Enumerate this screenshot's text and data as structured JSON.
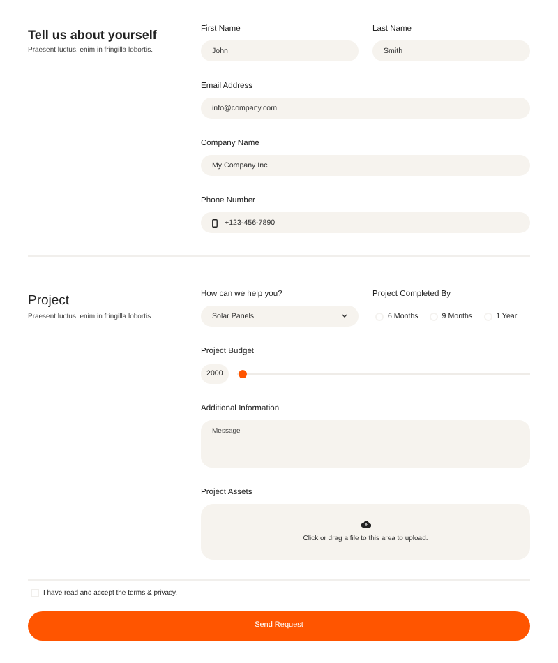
{
  "about": {
    "title": "Tell us about yourself",
    "subtitle": "Praesent luctus, enim in fringilla lobortis.",
    "fields": [
      {
        "label": "First Name",
        "value": "John",
        "kind": "half"
      },
      {
        "label": "Last Name",
        "value": "Smith",
        "kind": "half"
      },
      {
        "label": "Email Address",
        "value": "info@company.com",
        "kind": "full"
      },
      {
        "label": "Company Name",
        "value": "My Company Inc",
        "kind": "full"
      },
      {
        "label": "Phone Number",
        "value": "+123-456-7890",
        "kind": "phone"
      }
    ]
  },
  "project": {
    "title": "Project",
    "subtitle": "Praesent luctus, enim in fringilla lobortis.",
    "help": {
      "label": "How can we help you?",
      "value": "Solar Panels"
    },
    "completed": {
      "label": "Project Completed By",
      "options": [
        {
          "label": "6 Months",
          "selected": false
        },
        {
          "label": "9 Months",
          "selected": false
        },
        {
          "label": "1 Year",
          "selected": false
        }
      ]
    },
    "budget": {
      "label": "Project Budget",
      "reading": "2000",
      "level": 0.02
    },
    "info": {
      "label": "Additional Information",
      "placeholder": "Message"
    },
    "assets": {
      "label": "Project Assets",
      "hint": "Click or drag a file to this area to upload."
    }
  },
  "terms": {
    "label": "I have read and accept the terms & privacy.",
    "checked": false
  },
  "submit": "Send Request"
}
